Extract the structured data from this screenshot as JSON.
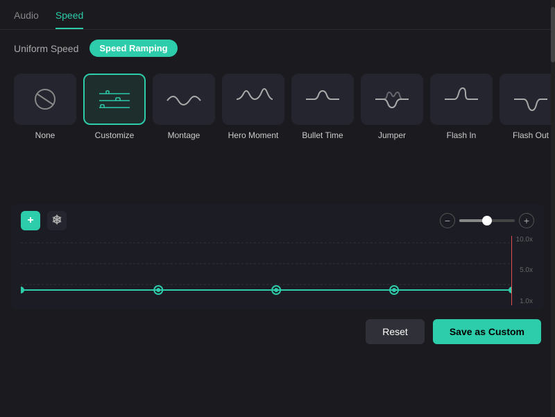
{
  "tabs": [
    {
      "id": "audio",
      "label": "Audio",
      "active": false
    },
    {
      "id": "speed",
      "label": "Speed",
      "active": true
    }
  ],
  "modes": [
    {
      "id": "uniform",
      "label": "Uniform Speed",
      "active": false
    },
    {
      "id": "ramping",
      "label": "Speed Ramping",
      "active": true
    }
  ],
  "presets": [
    {
      "id": "none",
      "label": "None",
      "wave": "none",
      "selected": false
    },
    {
      "id": "customize",
      "label": "Customize",
      "wave": "customize",
      "selected": true
    },
    {
      "id": "montage",
      "label": "Montage",
      "wave": "montage",
      "selected": false
    },
    {
      "id": "hero-moment",
      "label": "Hero Moment",
      "wave": "hero",
      "selected": false
    },
    {
      "id": "bullet-time",
      "label": "Bullet Time",
      "wave": "bullet",
      "selected": false
    },
    {
      "id": "jumper",
      "label": "Jumper",
      "wave": "jumper",
      "selected": false
    },
    {
      "id": "flash-in",
      "label": "Flash In",
      "wave": "flash-in",
      "selected": false
    },
    {
      "id": "flash-out",
      "label": "Flash Out",
      "wave": "flash-out",
      "selected": false
    }
  ],
  "toolbar": {
    "add_label": "+",
    "freeze_label": "❄",
    "reset_label": "Reset",
    "save_custom_label": "Save as Custom"
  },
  "graph": {
    "labels": [
      "10.0x",
      "5.0x",
      "1.0x"
    ]
  }
}
